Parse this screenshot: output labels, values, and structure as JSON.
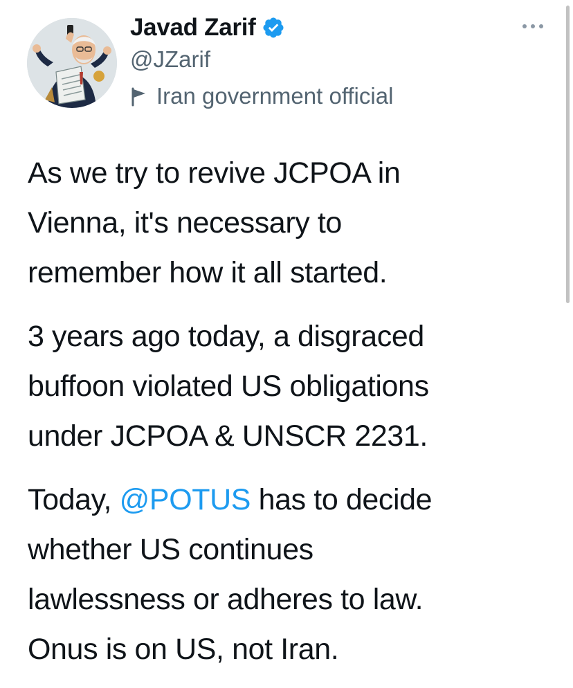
{
  "author": {
    "display_name": "Javad Zarif",
    "handle": "@JZarif",
    "label": "Iran government official",
    "verified": true,
    "avatar_icon": "caricature-avatar"
  },
  "colors": {
    "link": "#1d9bf0",
    "secondary_text": "#536471",
    "verified_badge": "#1d9bf0"
  },
  "tweet": {
    "p1": [
      "As we try to revive JCPOA in",
      "Vienna, it's necessary to",
      "remember how it all started."
    ],
    "p2": [
      "3 years ago today, a disgraced",
      "buffoon violated US obligations",
      "under JCPOA & UNSCR 2231."
    ],
    "p3_line1_prefix": "Today, ",
    "p3_mention": "@POTUS",
    "p3_line1_suffix": " has to decide",
    "p3_rest": [
      "whether US continues",
      "lawlessness or adheres to law.",
      "Onus is on US, not Iran."
    ]
  },
  "icons": {
    "more": "more-horizontal-icon",
    "verified": "verified-badge-icon",
    "flag": "government-flag-icon"
  }
}
